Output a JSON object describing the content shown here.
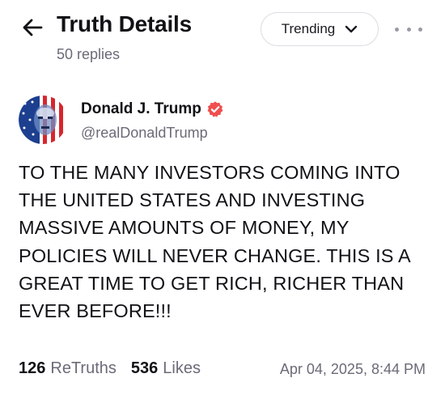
{
  "header": {
    "title": "Truth Details",
    "replies": "50 replies",
    "sort_label": "Trending",
    "back_icon": "arrow-left-icon",
    "more_icon": "more-horizontal-icon"
  },
  "post": {
    "author_name": "Donald J. Trump",
    "author_handle": "@realDonaldTrump",
    "verified_color": "#f04e4e",
    "body": "TO THE MANY INVESTORS COMING INTO THE UNITED STATES AND INVESTING MASSIVE AMOUNTS OF MONEY, MY POLICIES WILL NEVER CHANGE. THIS IS A GREAT TIME TO GET RICH, RICHER THAN EVER BEFORE!!!",
    "retruths_count": "126",
    "retruths_label": "ReTruths",
    "likes_count": "536",
    "likes_label": "Likes",
    "timestamp": "Apr 04, 2025, 8:44 PM"
  }
}
